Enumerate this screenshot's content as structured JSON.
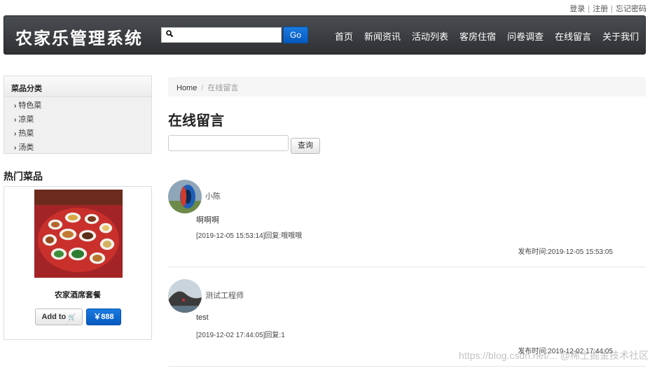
{
  "top_links": {
    "login": "登录",
    "register": "注册",
    "forgot": "忘记密码",
    "separator": "|"
  },
  "header": {
    "brand": "农家乐管理系统",
    "search": {
      "value": "",
      "placeholder": ""
    },
    "go_label": "Go",
    "nav": [
      "首页",
      "新闻资讯",
      "活动列表",
      "客房住宿",
      "问卷调查",
      "在线留言",
      "关于我们"
    ]
  },
  "sidebar": {
    "category_title": "菜品分类",
    "categories": [
      "特色菜",
      "凉菜",
      "热菜",
      "汤类"
    ],
    "hot_title": "热门菜品",
    "hot_item": {
      "name": "农家酒席套餐",
      "add_label": "Add to",
      "cart_icon": "🛒",
      "price": "￥888"
    }
  },
  "main": {
    "breadcrumb": {
      "home": "Home",
      "separator": "/",
      "current": "在线留言"
    },
    "title": "在线留言",
    "query": {
      "value": "",
      "button": "查询"
    },
    "messages": [
      {
        "user": "小陈",
        "content": "啊啊啊",
        "reply": "[2019-12-05 15:53:14]回复:哦哦哦",
        "time": "发布时间:2019-12-05 15:53:05"
      },
      {
        "user": "测试工程师",
        "content": "test",
        "reply": "[2019-12-02 17:44:05]回复:1",
        "time": "发布时间:2019-12-02 17:44:05"
      }
    ]
  },
  "watermark": "https://blog.csdn.net/...  @稀土掘金技术社区",
  "colors": {
    "header_bg": "#3a3d41",
    "primary_blue": "#0659c0",
    "breadcrumb_bg": "#f5f5f5"
  }
}
